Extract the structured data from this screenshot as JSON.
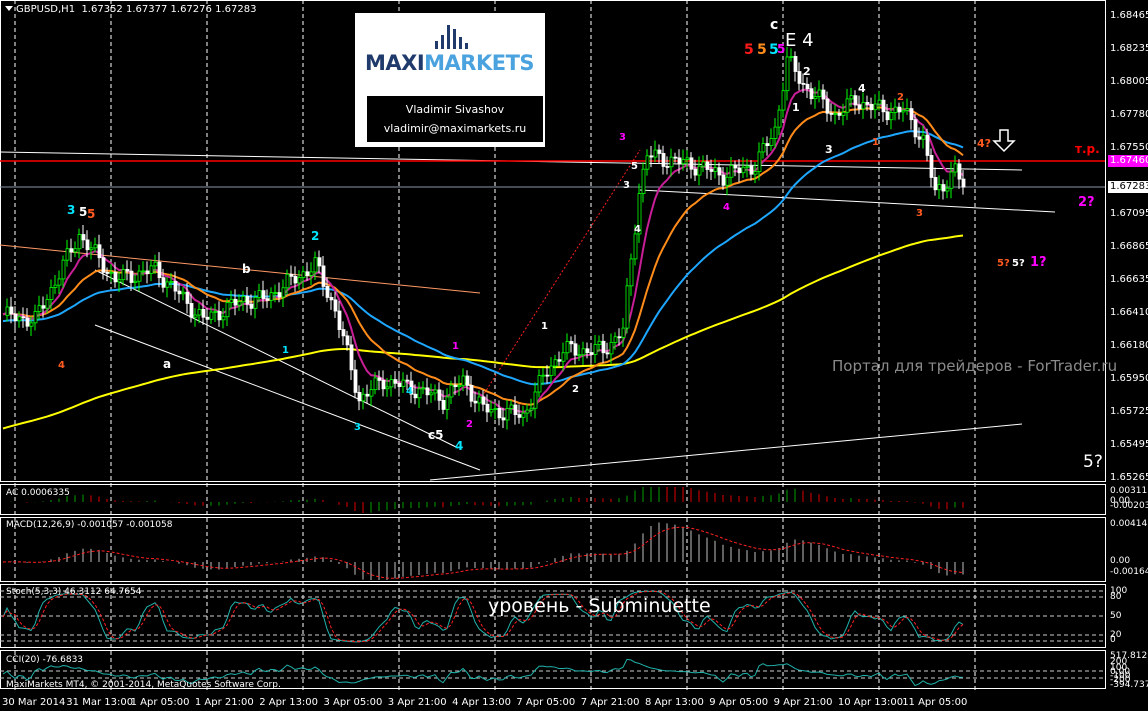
{
  "header": {
    "symbol": "GBPUSD,H1",
    "open": "1.67352",
    "high": "1.67377",
    "low": "1.67276",
    "close": "1.67283"
  },
  "logo": {
    "brand_left": "MAXI",
    "brand_right": "MARKETS",
    "author": "Vladimir Sivashov",
    "email": "vladimir@maximarkets.ru"
  },
  "watermark": "Портал для трейдеров - ForTrader.ru",
  "level_caption": "уровень - Subminuette",
  "copyright": "MaxiMarkets MT4, © 2001-2014, MetaQuotes Software Corp.",
  "target_label": "т.р.",
  "colors": {
    "up": "#00ff00",
    "down": "#ffffff",
    "ma_slow": "#ffff00",
    "ma_mid": "#1ea7ff",
    "ma_fast": "#ff8c1a",
    "ma_fastest": "#c81e96",
    "level_line": "#ff0000",
    "level_tag": "#ff00ff"
  },
  "price_axis": [
    "1.68465",
    "1.68235",
    "1.68005",
    "1.67780",
    "1.67550",
    "1.67095",
    "1.66865",
    "1.66635",
    "1.66410",
    "1.66180",
    "1.65950",
    "1.65725",
    "1.65495",
    "1.65265"
  ],
  "price_tags": {
    "level": "1.67460",
    "last": "1.67283"
  },
  "time_axis": [
    "30 Mar 2014",
    "31 Mar 13:00",
    "1 Apr 05:00",
    "1 Apr 21:00",
    "2 Apr 13:00",
    "3 Apr 05:00",
    "3 Apr 21:00",
    "4 Apr 13:00",
    "7 Apr 05:00",
    "7 Apr 21:00",
    "8 Apr 13:00",
    "9 Apr 05:00",
    "9 Apr 21:00",
    "10 Apr 13:00",
    "11 Apr 05:00"
  ],
  "indicators": {
    "ac": {
      "label": "AC 0.0006335",
      "axis": [
        "0.003115",
        "0.00",
        "-0.002033"
      ]
    },
    "macd": {
      "label": "MACD(12,26,9) -0.001057 -0.001058",
      "axis": [
        "0.004141",
        "0.00",
        "-0.00164"
      ]
    },
    "stoch": {
      "label": "Stoch(5,3,3) 46.3112 64.7654",
      "axis": [
        "100",
        "80",
        "50",
        "20",
        "0"
      ]
    },
    "cci": {
      "label": "CCI(20) -76.6833",
      "axis": [
        "517.812",
        "200",
        "100",
        "0.00",
        "-100",
        "-200",
        "-394.7378"
      ]
    }
  },
  "wave_labels": [
    "3",
    "5",
    "5",
    "4",
    "a",
    "b",
    "2",
    "1",
    "3",
    "4",
    "c5",
    "4",
    "1",
    "2",
    "2",
    "1",
    "3",
    "5",
    "3",
    "4",
    "4",
    "c",
    "5",
    "5",
    "5",
    "5",
    "E 4",
    "2",
    "1",
    "3",
    "4",
    "1",
    "2",
    "3",
    "4?",
    "2?",
    "5?",
    "5?",
    "1?",
    "5?"
  ],
  "chart_data": {
    "type": "candlestick",
    "title": "GBPUSD,H1",
    "xlabel": "",
    "ylabel": "",
    "ylim": [
      1.65265,
      1.68465
    ],
    "grid": true,
    "bar_index": [
      0,
      8,
      19,
      28,
      38,
      50,
      60,
      65,
      78,
      83,
      89,
      95,
      103,
      110,
      115,
      120,
      130,
      136,
      140,
      150,
      155,
      159,
      161,
      173,
      180,
      188,
      193,
      196,
      200,
      208,
      213,
      220,
      225,
      230,
      233,
      238,
      240
    ],
    "close": [
      1.6639,
      1.6636,
      1.6695,
      1.6664,
      1.6671,
      1.6636,
      1.665,
      1.665,
      1.6674,
      1.6643,
      1.6581,
      1.6594,
      1.6588,
      1.6581,
      1.6594,
      1.6574,
      1.657,
      1.6601,
      1.6615,
      1.6615,
      1.6629,
      1.6726,
      1.675,
      1.6743,
      1.6736,
      1.6743,
      1.6768,
      1.6816,
      1.6799,
      1.6778,
      1.6788,
      1.6781,
      1.6781,
      1.6761,
      1.6723,
      1.674,
      1.6728
    ]
  }
}
